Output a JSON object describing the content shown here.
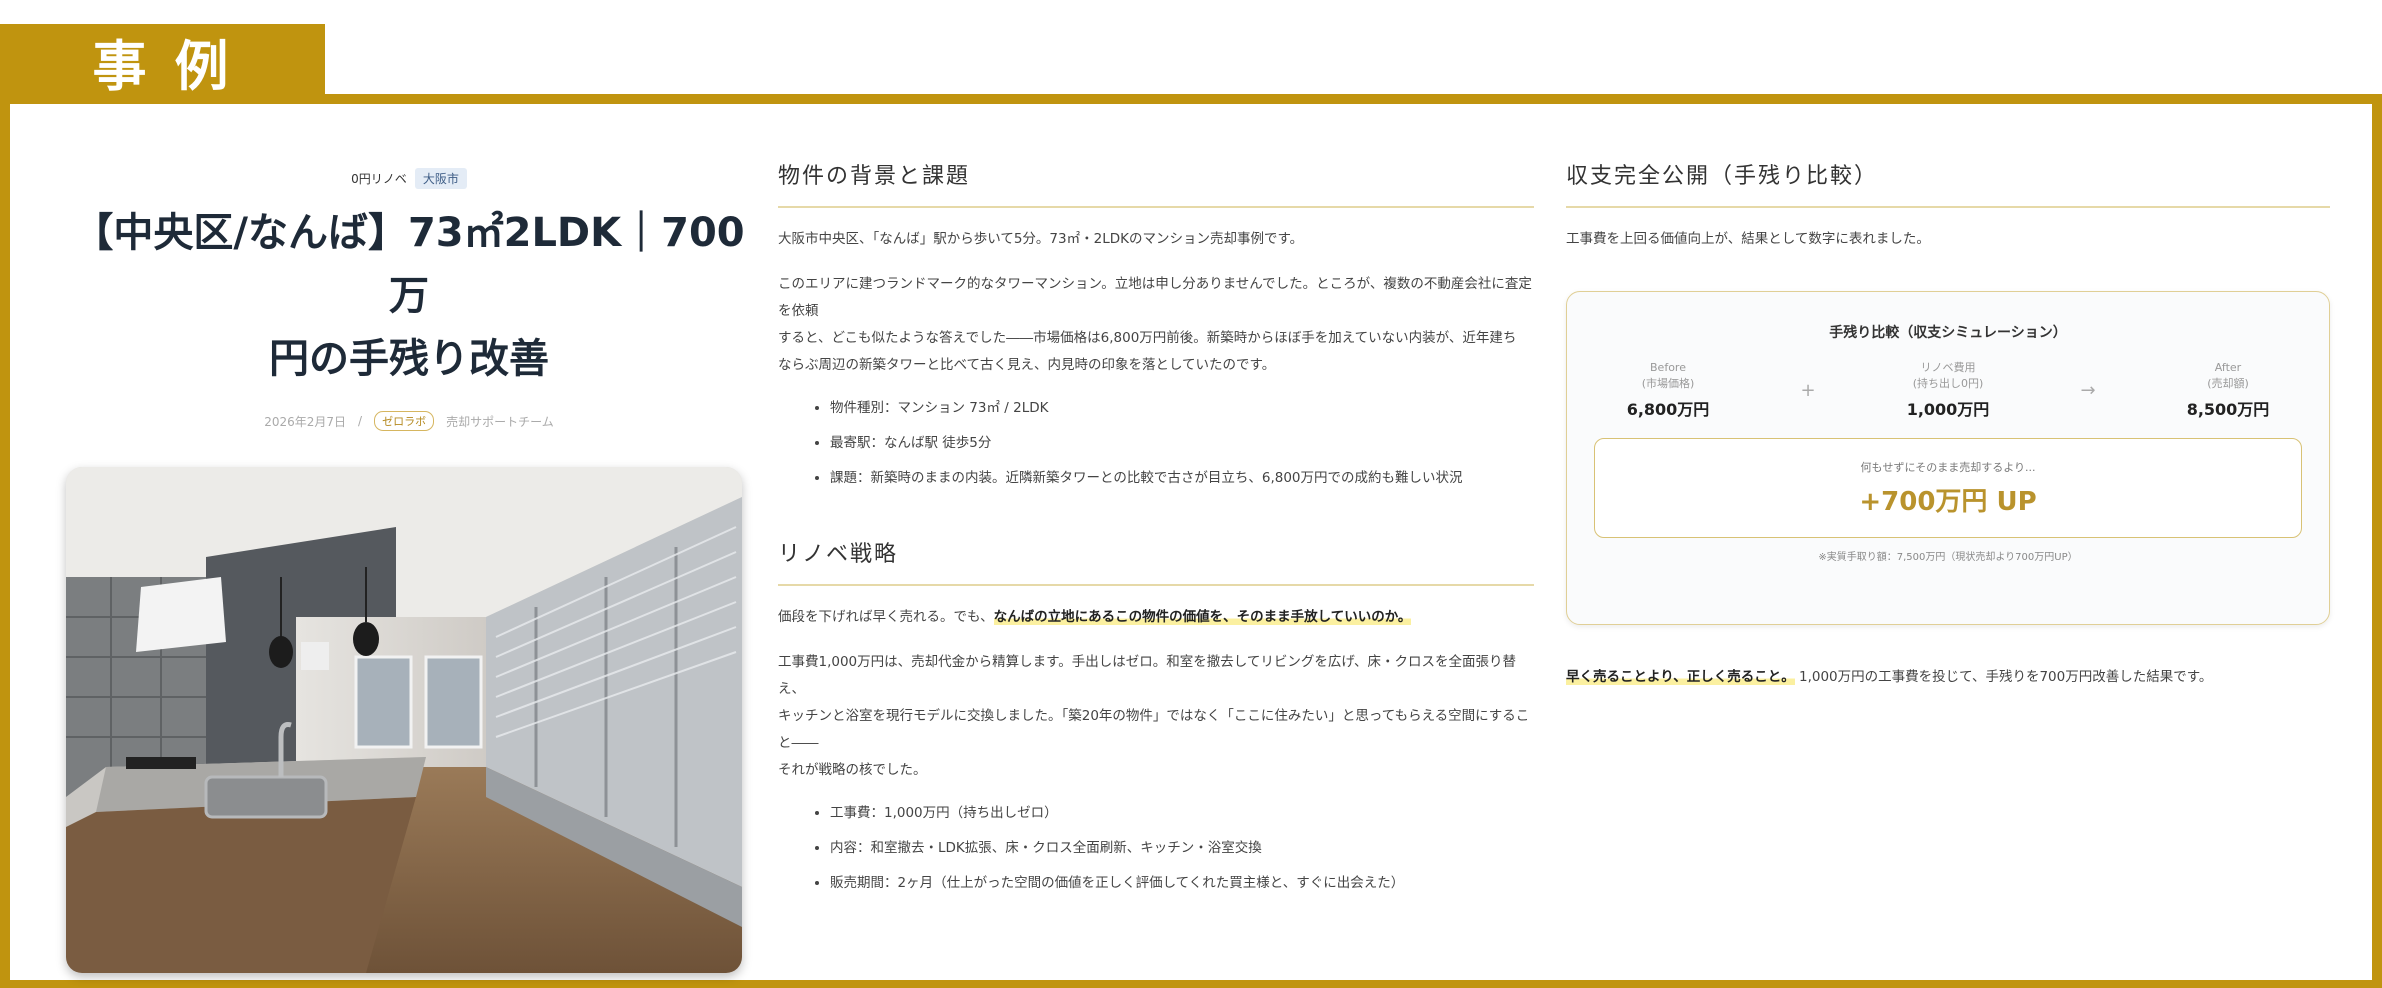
{
  "heading": "事例",
  "left": {
    "tag1": "0円リノベ",
    "tag2": "大阪市",
    "title_line1": "【中央区/なんば】73㎡2LDK｜700万",
    "title_line2": "円の手残り改善",
    "date": "2026年2月7日",
    "sep": "/",
    "badge": "ゼロラボ",
    "author": "売却サポートチーム"
  },
  "mid": {
    "sec1_title": "物件の背景と課題",
    "p1": "大阪市中央区、「なんば」駅から歩いて5分。73㎡・2LDKのマンション売却事例です。",
    "p2_l1": "このエリアに建つランドマーク的なタワーマンション。立地は申し分ありませんでした。ところが、複数の不動産会社に査定を依頼",
    "p2_l2": "すると、どこも似たような答えでした――市場価格は6,800万円前後。新築時からほぼ手を加えていない内装が、近年建ち",
    "p2_l3": "ならぶ周辺の新築タワーと比べて古く見え、内見時の印象を落としていたのです。",
    "bullets1": [
      "物件種別：マンション 73㎡ / 2LDK",
      "最寄駅：なんば駅 徒歩5分",
      "課題：新築時のままの内装。近隣新築タワーとの比較で古さが目立ち、6,800万円での成約も難しい状況"
    ],
    "sec2_title": "リノベ戦略",
    "p3_plain": "価段を下げれば早く売れる。でも、",
    "p3_hl": "なんばの立地にあるこの物件の価値を、そのまま手放していいのか。",
    "p4_l1": "工事費1,000万円は、売却代金から精算します。手出しはゼロ。和室を撤去してリビングを広げ、床・クロスを全面張り替え、",
    "p4_l2": "キッチンと浴室を現行モデルに交換しました。「築20年の物件」ではなく「ここに住みたい」と思ってもらえる空間にすること――",
    "p4_l3": "それが戦略の核でした。",
    "bullets2": [
      "工事費：1,000万円（持ち出しゼロ）",
      "内容：和室撤去・LDK拡張、床・クロス全面刷新、キッチン・浴室交換",
      "販売期間：2ヶ月（仕上がった空間の価値を正しく評価してくれた買主様と、すぐに出会えた）"
    ]
  },
  "right": {
    "sec_title": "収支完全公開（手残り比較）",
    "intro": "工事費を上回る価値向上が、結果として数字に表れました。",
    "card_title": "手残り比較（収支シミュレーション）",
    "before_label1": "Before",
    "before_label2": "(市場価格)",
    "before_val": "6,800万円",
    "plus": "+",
    "reno_label1": "リノベ費用",
    "reno_label2": "(持ち出し0円)",
    "reno_val": "1,000万円",
    "arrow": "→",
    "after_label1": "After",
    "after_label2": "(売却額)",
    "after_val": "8,500万円",
    "result_caption": "何もせずにそのまま売却するより...",
    "result_value": "+700万円 UP",
    "note": "※実質手取り額：7,500万円（現状売却より700万円UP）",
    "concl_hl": "早く売ることより、正しく売ること。",
    "concl_plain": "1,000万円の工事費を投じて、手残りを700万円改善した結果です。"
  },
  "colors": {
    "accent": "#c0940f",
    "highlight": "#fbf0a0",
    "result": "#b9932d"
  }
}
